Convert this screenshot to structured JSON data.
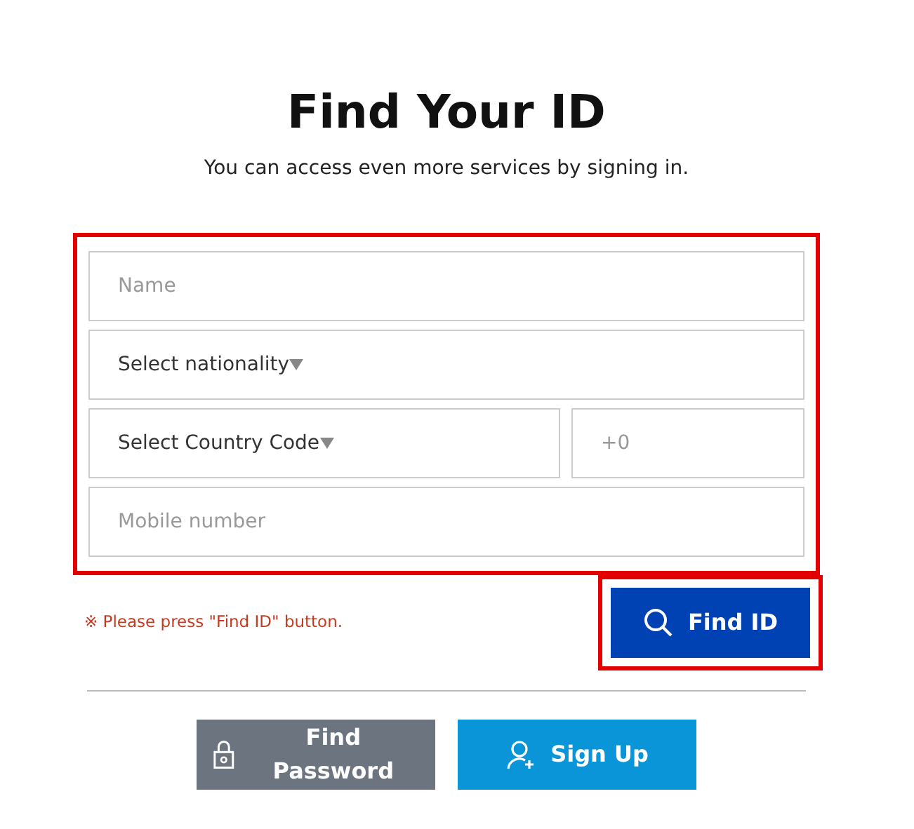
{
  "title": "Find Your ID",
  "subtitle": "You can access even more services by signing in.",
  "form": {
    "highlighted": true,
    "rows": [
      [
        {
          "kind": "input",
          "placeholder": "Name"
        }
      ],
      [
        {
          "kind": "select",
          "placeholder": "Select nationality"
        }
      ],
      [
        {
          "kind": "select",
          "placeholder": "Select Country Code"
        },
        {
          "kind": "input",
          "placeholder": "+0"
        }
      ],
      [
        {
          "kind": "input",
          "placeholder": "Mobile number"
        }
      ]
    ]
  },
  "notice": "※ Please press \"Find ID\" button.",
  "find_button": {
    "label": "Find ID",
    "highlighted": true
  },
  "bottom_buttons": [
    {
      "kind": "password",
      "label": "Find Password"
    },
    {
      "kind": "signup",
      "label": "Sign Up"
    }
  ]
}
